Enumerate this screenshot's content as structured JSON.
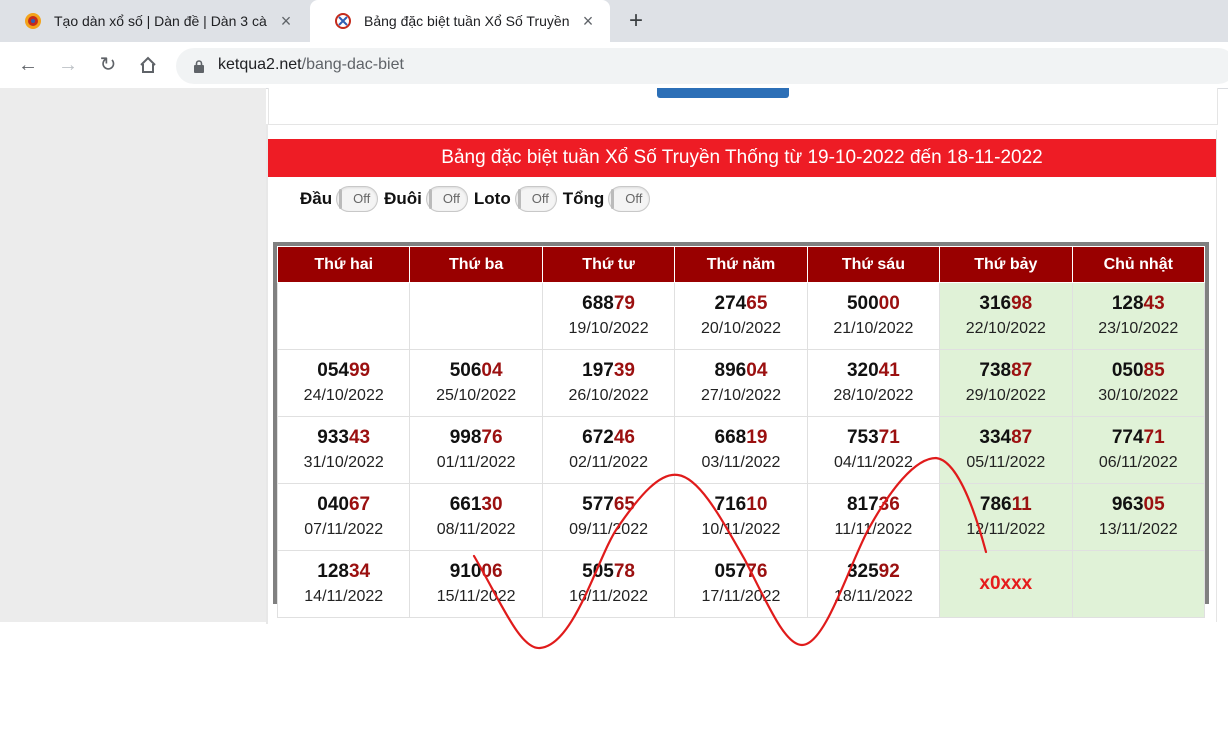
{
  "browser": {
    "tabs": [
      {
        "title": "Tạo dàn xổ số | Dàn đề | Dàn 3 cà",
        "active": false
      },
      {
        "title": "Bảng đặc biệt tuần Xổ Số Truyền",
        "active": true
      }
    ],
    "new_tab": "+",
    "url_domain": "ketqua2.net",
    "url_path": "/bang-dac-biet"
  },
  "banner": "Bảng đặc biệt tuần Xổ Số Truyền Thống từ 19-10-2022 đến 18-11-2022",
  "toggles": [
    {
      "label": "Đầu",
      "state": "Off"
    },
    {
      "label": "Đuôi",
      "state": "Off"
    },
    {
      "label": "Loto",
      "state": "Off"
    },
    {
      "label": "Tổng",
      "state": "Off"
    }
  ],
  "table": {
    "headers": [
      "Thứ hai",
      "Thứ ba",
      "Thứ tư",
      "Thứ năm",
      "Thứ sáu",
      "Thứ bảy",
      "Chủ nhật"
    ],
    "rows": [
      [
        null,
        null,
        {
          "head": "688",
          "tail": "79",
          "date": "19/10/2022"
        },
        {
          "head": "274",
          "tail": "65",
          "date": "20/10/2022"
        },
        {
          "head": "500",
          "tail": "00",
          "date": "21/10/2022"
        },
        {
          "head": "316",
          "tail": "98",
          "date": "22/10/2022"
        },
        {
          "head": "128",
          "tail": "43",
          "date": "23/10/2022"
        }
      ],
      [
        {
          "head": "054",
          "tail": "99",
          "date": "24/10/2022"
        },
        {
          "head": "506",
          "tail": "04",
          "date": "25/10/2022"
        },
        {
          "head": "197",
          "tail": "39",
          "date": "26/10/2022"
        },
        {
          "head": "896",
          "tail": "04",
          "date": "27/10/2022"
        },
        {
          "head": "320",
          "tail": "41",
          "date": "28/10/2022"
        },
        {
          "head": "738",
          "tail": "87",
          "date": "29/10/2022"
        },
        {
          "head": "050",
          "tail": "85",
          "date": "30/10/2022"
        }
      ],
      [
        {
          "head": "933",
          "tail": "43",
          "date": "31/10/2022"
        },
        {
          "head": "998",
          "tail": "76",
          "date": "01/11/2022"
        },
        {
          "head": "672",
          "tail": "46",
          "date": "02/11/2022"
        },
        {
          "head": "668",
          "tail": "19",
          "date": "03/11/2022"
        },
        {
          "head": "753",
          "tail": "71",
          "date": "04/11/2022"
        },
        {
          "head": "334",
          "tail": "87",
          "date": "05/11/2022"
        },
        {
          "head": "774",
          "tail": "71",
          "date": "06/11/2022"
        }
      ],
      [
        {
          "head": "040",
          "tail": "67",
          "date": "07/11/2022"
        },
        {
          "head": "661",
          "tail": "30",
          "date": "08/11/2022"
        },
        {
          "head": "577",
          "tail": "65",
          "date": "09/11/2022"
        },
        {
          "head": "716",
          "tail": "10",
          "date": "10/11/2022"
        },
        {
          "head": "817",
          "tail": "36",
          "date": "11/11/2022"
        },
        {
          "head": "786",
          "tail": "11",
          "date": "12/11/2022"
        },
        {
          "head": "963",
          "tail": "05",
          "date": "13/11/2022"
        }
      ],
      [
        {
          "head": "128",
          "tail": "34",
          "date": "14/11/2022"
        },
        {
          "head": "910",
          "tail": "06",
          "date": "15/11/2022"
        },
        {
          "head": "505",
          "tail": "78",
          "date": "16/11/2022"
        },
        {
          "head": "057",
          "tail": "76",
          "date": "17/11/2022"
        },
        {
          "head": "325",
          "tail": "92",
          "date": "18/11/2022"
        },
        {
          "pending": "x0xxx"
        },
        null
      ]
    ]
  },
  "colors": {
    "banner_bg": "#ee1c25",
    "header_bg": "#990000",
    "weekend_bg": "#e0f2d7",
    "tail_digit": "#9b1010",
    "scribble": "#e01b1b"
  }
}
